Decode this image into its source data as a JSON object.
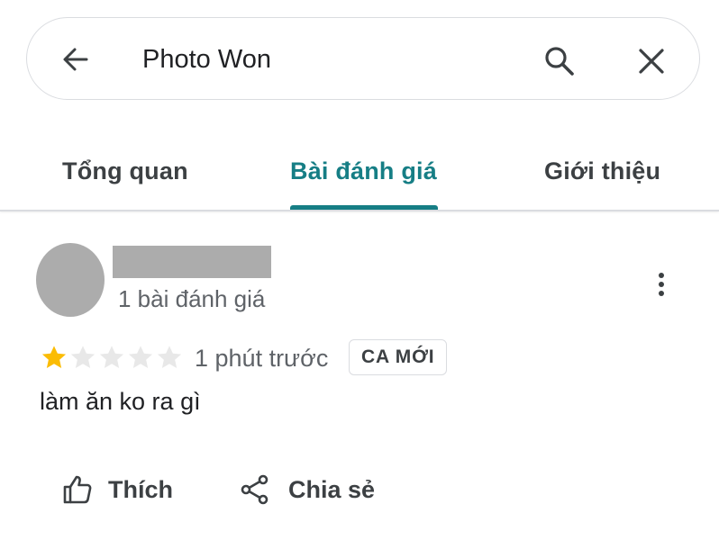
{
  "search": {
    "query": "Photo Won",
    "back_icon": "arrow-back-icon",
    "search_icon": "search-icon",
    "close_icon": "close-icon"
  },
  "tabs": [
    {
      "label": "Tổng quan",
      "active": false
    },
    {
      "label": "Bài đánh giá",
      "active": true
    },
    {
      "label": "Giới thiệu",
      "active": false
    }
  ],
  "review": {
    "reviewer_review_count": "1 bài đánh giá",
    "rating": 1,
    "rating_max": 5,
    "time": "1 phút trước",
    "badge": "CA MỚI",
    "text": "làm ăn ko ra gì",
    "more_icon": "more-vertical-icon"
  },
  "actions": {
    "like_label": "Thích",
    "like_icon": "thumbs-up-icon",
    "share_label": "Chia sẻ",
    "share_icon": "share-icon"
  },
  "colors": {
    "accent": "#167e85",
    "star_filled": "#fbbc04",
    "star_empty": "#e8e8e8",
    "redacted": "#acacac"
  }
}
